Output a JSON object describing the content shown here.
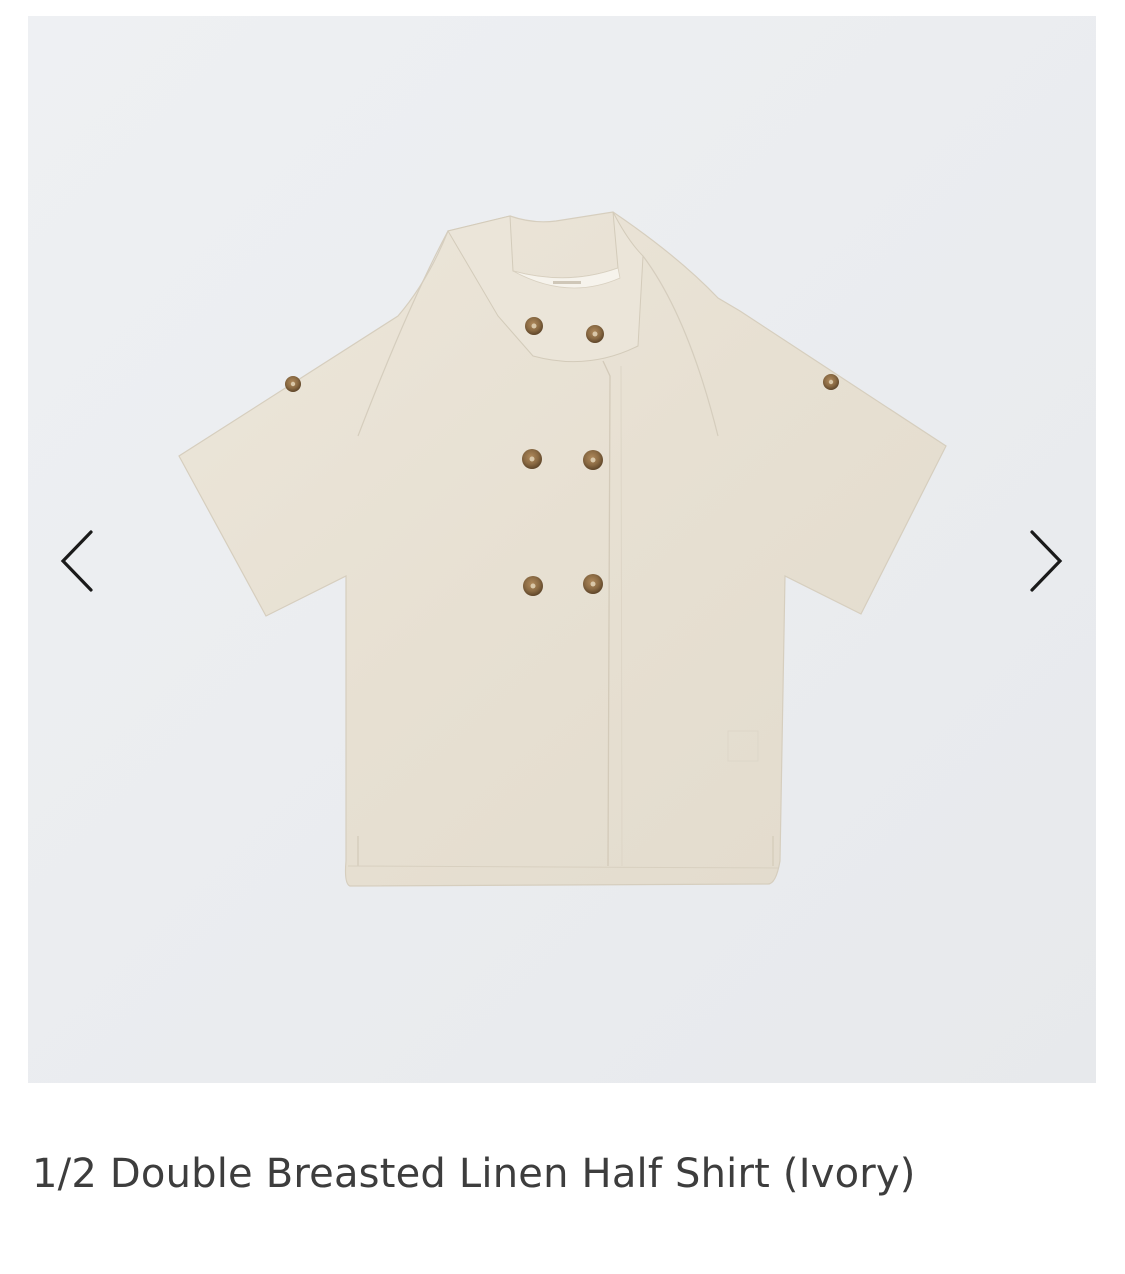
{
  "product": {
    "title": "1/2 Double Breasted Linen Half Shirt (Ivory)",
    "image_subject": "ivory linen double breasted half shirt"
  },
  "gallery": {
    "prev_icon": "chevron-left-icon",
    "next_icon": "chevron-right-icon"
  },
  "colors": {
    "gallery_background": "#ebedf0",
    "garment": "#e8e1d4",
    "buttons": "#8a6a43",
    "title_text": "#3d3d3d"
  }
}
